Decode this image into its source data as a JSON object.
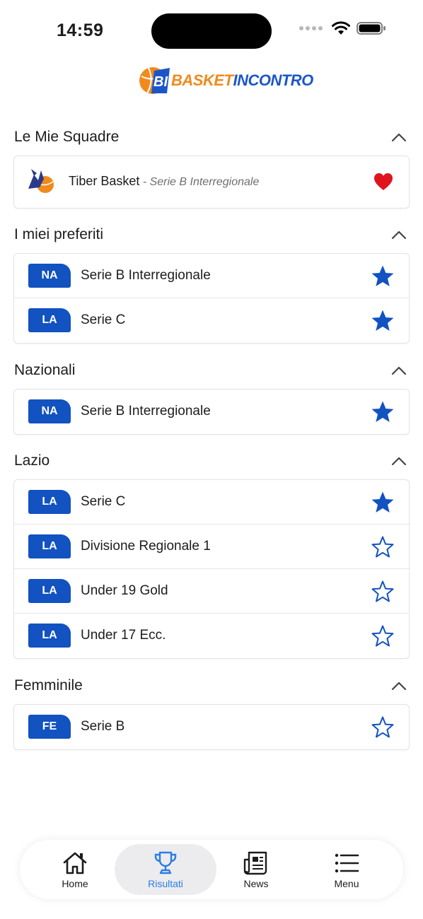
{
  "status_bar": {
    "time": "14:59"
  },
  "brand": {
    "logo_letters": "BI",
    "name_part1": "BASKET",
    "name_part2": "INCONTRO",
    "orange": "#f08a1c",
    "blue": "#1b56c9"
  },
  "colors": {
    "badge": "#1252c1",
    "star": "#1252c1",
    "heart": "#e0141c",
    "active_tab": "#2a7de1"
  },
  "sections": {
    "my_teams": {
      "title": "Le Mie Squadre",
      "team": {
        "name": "Tiber Basket",
        "separator": " - ",
        "league": "Serie B Interregionale",
        "icon": "heart-icon"
      }
    },
    "favorites": {
      "title": "I miei preferiti",
      "items": [
        {
          "badge": "NA",
          "label": "Serie B Interregionale",
          "starred": true
        },
        {
          "badge": "LA",
          "label": "Serie C",
          "starred": true
        }
      ]
    },
    "nazionali": {
      "title": "Nazionali",
      "items": [
        {
          "badge": "NA",
          "label": "Serie B Interregionale",
          "starred": true
        }
      ]
    },
    "lazio": {
      "title": "Lazio",
      "items": [
        {
          "badge": "LA",
          "label": "Serie C",
          "starred": true
        },
        {
          "badge": "LA",
          "label": "Divisione Regionale 1",
          "starred": false
        },
        {
          "badge": "LA",
          "label": "Under 19 Gold",
          "starred": false
        },
        {
          "badge": "LA",
          "label": "Under 17 Ecc.",
          "starred": false
        }
      ]
    },
    "femminile": {
      "title": "Femminile",
      "items": [
        {
          "badge": "FE",
          "label": "Serie B",
          "starred": false
        }
      ]
    }
  },
  "tabbar": {
    "home": {
      "label": "Home",
      "icon": "home-icon"
    },
    "results": {
      "label": "Risultati",
      "icon": "trophy-icon",
      "active": true
    },
    "news": {
      "label": "News",
      "icon": "newspaper-icon"
    },
    "menu": {
      "label": "Menu",
      "icon": "menu-icon"
    }
  }
}
